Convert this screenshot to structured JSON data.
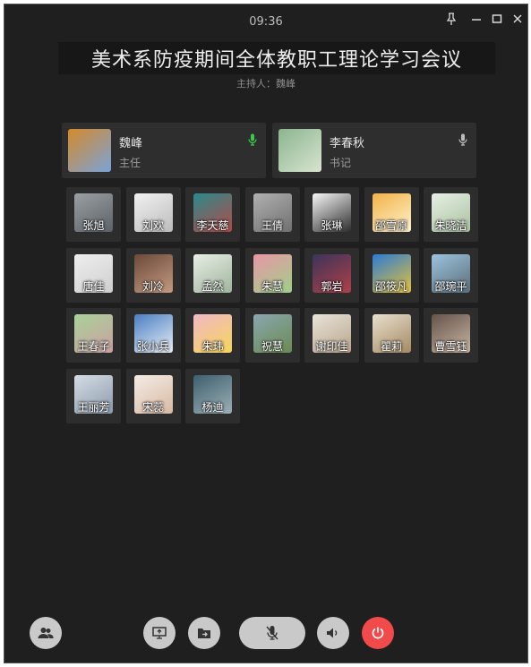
{
  "window": {
    "time": "09:36"
  },
  "meeting": {
    "title": "美术系防疫期间全体教职工理论学习会议",
    "host": "主持人：魏峰"
  },
  "leads": [
    {
      "name": "魏峰",
      "role": "主任",
      "mic_color": "#3cc94d",
      "avatar_colors": [
        "#d48a2a",
        "#7aa3d9"
      ]
    },
    {
      "name": "李春秋",
      "role": "书记",
      "mic_color": "#bdbdbd",
      "avatar_colors": [
        "#8bb58f",
        "#d8e4d0"
      ]
    }
  ],
  "participants": [
    {
      "name": "张旭",
      "colors": [
        "#9aa0a4",
        "#5b6166"
      ]
    },
    {
      "name": "刘欢",
      "colors": [
        "#f1f1f1",
        "#bcbcbc"
      ]
    },
    {
      "name": "李天慈",
      "colors": [
        "#2a8a8a",
        "#b54a4a"
      ]
    },
    {
      "name": "王倩",
      "colors": [
        "#b0b0b0",
        "#707070"
      ]
    },
    {
      "name": "张琳",
      "colors": [
        "#f7f7f7",
        "#2d2d2d"
      ]
    },
    {
      "name": "邵雪原",
      "colors": [
        "#f2b24a",
        "#fff3cc"
      ]
    },
    {
      "name": "朱晓洁",
      "colors": [
        "#e7f0e5",
        "#a9c1a0"
      ]
    },
    {
      "name": "唐佳",
      "colors": [
        "#eeeeee",
        "#cfcfcf"
      ]
    },
    {
      "name": "刘冷",
      "colors": [
        "#6a4a3a",
        "#c49a80"
      ]
    },
    {
      "name": "孟然",
      "colors": [
        "#e8eee6",
        "#9fb59c"
      ]
    },
    {
      "name": "朱慧",
      "colors": [
        "#e996a6",
        "#9fcf8a"
      ]
    },
    {
      "name": "郭岩",
      "colors": [
        "#3b3458",
        "#b0404a"
      ]
    },
    {
      "name": "邵筱凡",
      "colors": [
        "#2b7bd3",
        "#e6c23a"
      ]
    },
    {
      "name": "邵琬平",
      "colors": [
        "#9cc3dc",
        "#5b6d7a"
      ]
    },
    {
      "name": "王春子",
      "colors": [
        "#a9d29a",
        "#caa0a0"
      ]
    },
    {
      "name": "张小兵",
      "colors": [
        "#4b7ec2",
        "#e8f0f8"
      ]
    },
    {
      "name": "朱玮",
      "colors": [
        "#f1b7c6",
        "#f6d65a"
      ]
    },
    {
      "name": "祝慧",
      "colors": [
        "#8aa7b0",
        "#6b8a52"
      ]
    },
    {
      "name": "谢印佳",
      "colors": [
        "#e9e4da",
        "#b8a48a"
      ]
    },
    {
      "name": "瞿莉",
      "colors": [
        "#e9dfcd",
        "#a38a62"
      ]
    },
    {
      "name": "曹雪钰",
      "colors": [
        "#64544a",
        "#c9b6a2"
      ]
    },
    {
      "name": "王丽芳",
      "colors": [
        "#d5dde6",
        "#8b9aaa"
      ]
    },
    {
      "name": "宋蕊",
      "colors": [
        "#f4ece6",
        "#d8b9a2"
      ]
    },
    {
      "name": "杨迪",
      "colors": [
        "#3d5f6e",
        "#9cb0b5"
      ]
    }
  ],
  "controls": {
    "contacts_icon": "people-icon",
    "screen_share_icon": "screen-share-icon",
    "file_share_icon": "folder-share-icon",
    "mute_icon": "mic-muted-icon",
    "speaker_icon": "speaker-icon",
    "hangup_icon": "power-icon",
    "hangup_color": "#f04a4a"
  }
}
